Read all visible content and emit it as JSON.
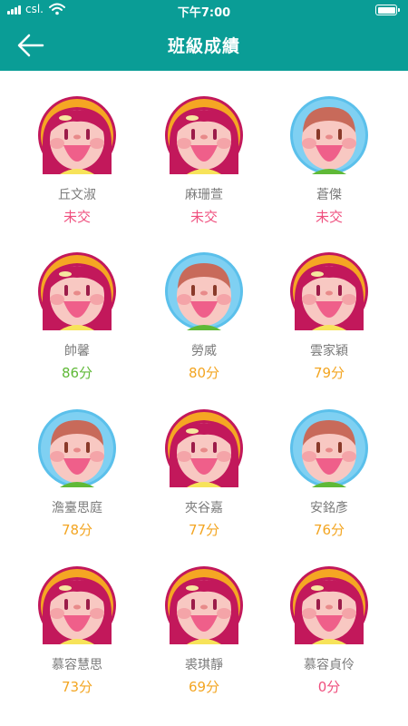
{
  "status_bar": {
    "carrier": "csl.",
    "time": "下午7:00"
  },
  "nav": {
    "title": "班級成績",
    "back_icon": "arrow-left-icon"
  },
  "colors": {
    "header_bg": "#0a9d96",
    "not_submitted": "#ef4f7e",
    "score_green": "#5fb937",
    "score_orange": "#f3a521",
    "name_gray": "#7b7b7b"
  },
  "students": [
    {
      "name": "丘文淑",
      "score": "未交",
      "avatar": "girl-avatar",
      "status": "missing"
    },
    {
      "name": "麻珊萱",
      "score": "未交",
      "avatar": "girl-avatar",
      "status": "missing"
    },
    {
      "name": "蒼傑",
      "score": "未交",
      "avatar": "boy-avatar",
      "status": "missing"
    },
    {
      "name": "帥馨",
      "score": "86分",
      "avatar": "girl-avatar",
      "status": "high"
    },
    {
      "name": "勞威",
      "score": "80分",
      "avatar": "boy-avatar",
      "status": "mid"
    },
    {
      "name": "雲家穎",
      "score": "79分",
      "avatar": "girl-avatar",
      "status": "mid"
    },
    {
      "name": "澹臺思庭",
      "score": "78分",
      "avatar": "boy-avatar",
      "status": "mid"
    },
    {
      "name": "夾谷嘉",
      "score": "77分",
      "avatar": "girl-avatar",
      "status": "mid"
    },
    {
      "name": "安銘彥",
      "score": "76分",
      "avatar": "boy-avatar",
      "status": "mid"
    },
    {
      "name": "慕容慧思",
      "score": "73分",
      "avatar": "girl-avatar",
      "status": "mid"
    },
    {
      "name": "裘琪靜",
      "score": "69分",
      "avatar": "girl-avatar",
      "status": "mid"
    },
    {
      "name": "慕容貞伶",
      "score": "0分",
      "avatar": "girl-avatar",
      "status": "missing"
    }
  ]
}
